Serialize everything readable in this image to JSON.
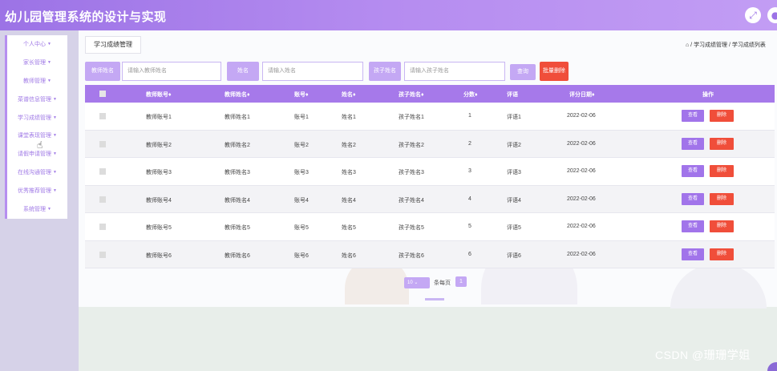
{
  "app": {
    "title": "幼儿园管理系统的设计与实现",
    "icons": [
      "fullscreen-icon",
      "user-icon"
    ]
  },
  "sidebar": {
    "items": [
      {
        "label": "个人中心"
      },
      {
        "label": "家长管理"
      },
      {
        "label": "教师管理"
      },
      {
        "label": "菜谱信息管理"
      },
      {
        "label": "学习成绩管理"
      },
      {
        "label": "课堂表现管理"
      },
      {
        "label": "请假申请管理"
      },
      {
        "label": "在线沟通管理"
      },
      {
        "label": "优秀推荐管理"
      },
      {
        "label": "系统管理"
      }
    ]
  },
  "tab": {
    "label": "学习成绩管理"
  },
  "breadcrumb": {
    "text": "⌂ / 学习成绩管理 / 学习成绩列表"
  },
  "search": {
    "teacher_name_label": "教师姓名",
    "teacher_name_placeholder": "请输入教师姓名",
    "name_label": "姓名",
    "name_placeholder": "请输入姓名",
    "child_name_label": "孩子姓名",
    "child_name_placeholder": "请输入孩子姓名",
    "query_button": "查询",
    "batch_delete_button": "批量删除"
  },
  "table": {
    "headers": [
      "教师账号♦",
      "教师姓名♦",
      "账号♦",
      "姓名♦",
      "孩子姓名♦",
      "分数♦",
      "评语",
      "评分日期♦",
      "操作"
    ],
    "rows": [
      [
        "教师账号1",
        "教师姓名1",
        "账号1",
        "姓名1",
        "孩子姓名1",
        "1",
        "评语1",
        "2022-02-06"
      ],
      [
        "教师账号2",
        "教师姓名2",
        "账号2",
        "姓名2",
        "孩子姓名2",
        "2",
        "评语2",
        "2022-02-06"
      ],
      [
        "教师账号3",
        "教师姓名3",
        "账号3",
        "姓名3",
        "孩子姓名3",
        "3",
        "评语3",
        "2022-02-06"
      ],
      [
        "教师账号4",
        "教师姓名4",
        "账号4",
        "姓名4",
        "孩子姓名4",
        "4",
        "评语4",
        "2022-02-06"
      ],
      [
        "教师账号5",
        "教师姓名5",
        "账号5",
        "姓名5",
        "孩子姓名5",
        "5",
        "评语5",
        "2022-02-06"
      ],
      [
        "教师账号6",
        "教师姓名6",
        "账号6",
        "姓名6",
        "孩子姓名6",
        "6",
        "评语6",
        "2022-02-06"
      ]
    ],
    "view_button": "查看",
    "delete_button": "删除"
  },
  "pager": {
    "page_size": "10",
    "per_page_text": "条每页",
    "current_page": "1"
  },
  "watermark": "CSDN @珊珊学姐",
  "colors": {
    "accent": "#a679ea",
    "danger": "#f04e3a"
  }
}
